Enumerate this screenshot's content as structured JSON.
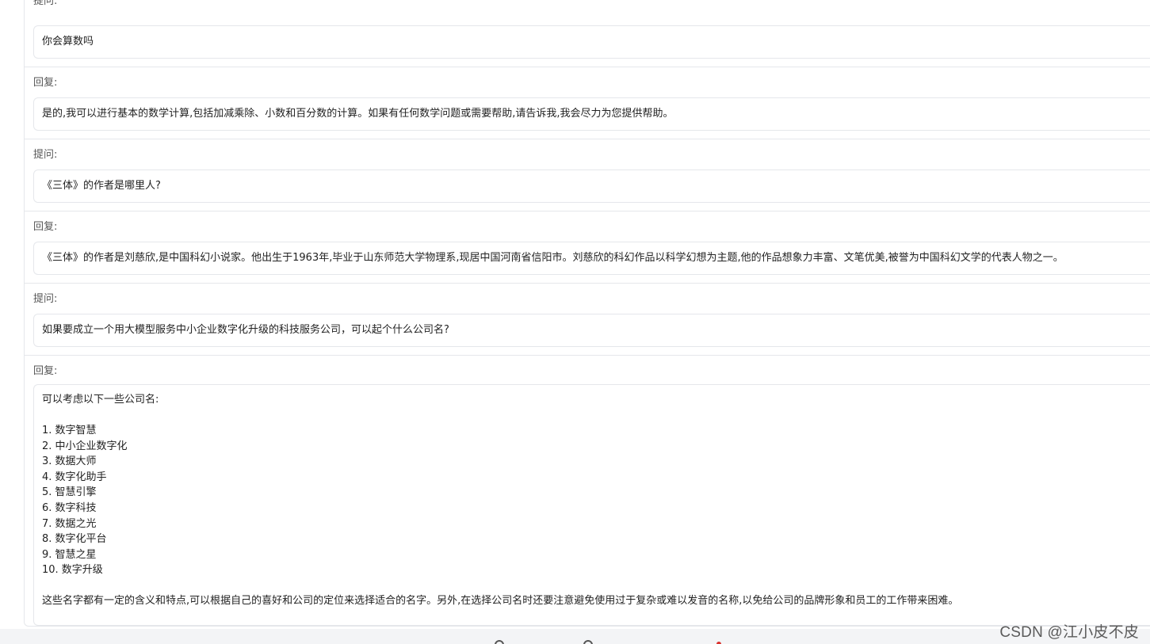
{
  "conversation": {
    "turns": [
      {
        "role_label": "提问:",
        "lines": [
          "你会算数吗"
        ]
      },
      {
        "role_label": "回复:",
        "lines": [
          "是的,我可以进行基本的数学计算,包括加减乘除、小数和百分数的计算。如果有任何数学问题或需要帮助,请告诉我,我会尽力为您提供帮助。"
        ]
      },
      {
        "role_label": "提问:",
        "lines": [
          "《三体》的作者是哪里人?"
        ]
      },
      {
        "role_label": "回复:",
        "lines": [
          "《三体》的作者是刘慈欣,是中国科幻小说家。他出生于1963年,毕业于山东师范大学物理系,现居中国河南省信阳市。刘慈欣的科幻作品以科学幻想为主题,他的作品想象力丰富、文笔优美,被誉为中国科幻文学的代表人物之一。"
        ]
      },
      {
        "role_label": "提问:",
        "lines": [
          "如果要成立一个用大模型服务中小企业数字化升级的科技服务公司，可以起个什么公司名?"
        ]
      },
      {
        "role_label": "回复:",
        "intro": "可以考虑以下一些公司名:",
        "list": [
          "1. 数字智慧",
          "2. 中小企业数字化",
          "3. 数据大师",
          "4. 数字化助手",
          "5. 智慧引擎",
          "6. 数字科技",
          "7. 数据之光",
          "8. 数字化平台",
          "9. 智慧之星",
          "10. 数字升级"
        ],
        "outro": "这些名字都有一定的含义和特点,可以根据自己的喜好和公司的定位来选择适合的名字。另外,在选择公司名时还要注意避免使用过于复杂或难以发音的名称,以免给公司的品牌形象和员工的工作带来困难。"
      }
    ]
  },
  "watermark": "CSDN @江小皮不皮",
  "colors": {
    "border": "#e5e7eb",
    "bottom_bar": "#f3f4f6",
    "accent_dot": "#d9302c"
  }
}
